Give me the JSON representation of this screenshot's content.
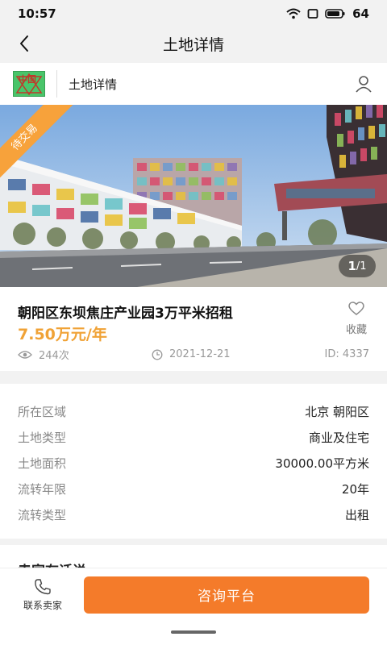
{
  "status_bar": {
    "time": "10:57",
    "battery": "64",
    "icons": [
      "wifi-icon",
      "screen-icon",
      "battery-icon"
    ]
  },
  "nav": {
    "title": "土地详情",
    "back_icon": "back-arrow-icon"
  },
  "brand": {
    "logo_text": "中国",
    "title": "土地详情",
    "user_icon": "user-icon"
  },
  "hero": {
    "badge": "待交易",
    "page_current": "1",
    "page_separator": "/",
    "page_total": "1"
  },
  "listing": {
    "title": "朝阳区东坝焦庄产业园3万平米招租",
    "price": "7.50万元/年",
    "favorite_label": "收藏",
    "views": "244次",
    "date": "2021-12-21",
    "id": "ID: 4337"
  },
  "attributes": [
    {
      "label": "所在区域",
      "value": "北京 朝阳区"
    },
    {
      "label": "土地类型",
      "value": "商业及住宅"
    },
    {
      "label": "土地面积",
      "value": "30000.00平方米"
    },
    {
      "label": "流转年限",
      "value": "20年"
    },
    {
      "label": "流转类型",
      "value": "出租"
    }
  ],
  "next_section": {
    "title": "卖家有话说"
  },
  "bottom": {
    "contact_label": "联系卖家",
    "consult_label": "咨询平台"
  },
  "colors": {
    "accent_orange": "#f47b2a",
    "price": "#f0a236",
    "badge": "#f7a23b"
  }
}
